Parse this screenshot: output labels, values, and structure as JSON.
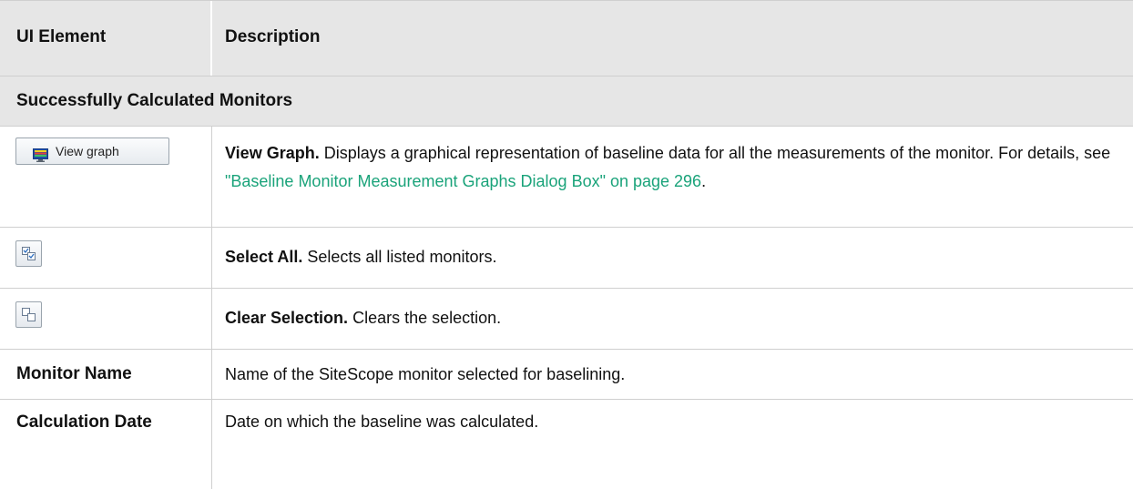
{
  "header": {
    "col1": "UI Element",
    "col2": "Description"
  },
  "section": {
    "title": "Successfully Calculated Monitors"
  },
  "rows": [
    {
      "button_label": "View graph",
      "icon": "monitor-graph-icon",
      "term": "View Graph.",
      "text": "Displays a graphical representation of baseline data for all the measurements of the monitor. For details, see",
      "link": "\"Baseline Monitor Measurement Graphs Dialog Box\" on page 296",
      "text_after": "."
    },
    {
      "icon": "select-all-icon",
      "term": "Select All.",
      "text": "Selects all listed monitors."
    },
    {
      "icon": "clear-selection-icon",
      "term": "Clear Selection.",
      "text": "Clears the selection."
    },
    {
      "element": "Monitor Name",
      "text": "Name of the SiteScope monitor selected for baselining."
    },
    {
      "element": "Calculation Date",
      "text": "Date on which the baseline was calculated."
    }
  ],
  "colors": {
    "header_bg": "#e6e6e6",
    "link": "#1aa37a",
    "border": "#cfcfcf"
  }
}
